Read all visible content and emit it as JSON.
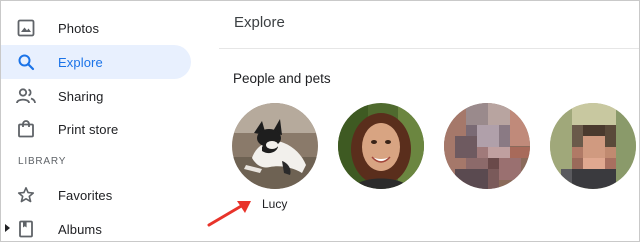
{
  "sidebar": {
    "items": [
      {
        "label": "Photos",
        "icon": "photo-icon"
      },
      {
        "label": "Explore",
        "icon": "search-icon",
        "active": true
      },
      {
        "label": "Sharing",
        "icon": "people-icon"
      },
      {
        "label": "Print store",
        "icon": "shopping-bag-icon"
      }
    ],
    "section_label": "LIBRARY",
    "library_items": [
      {
        "label": "Favorites",
        "icon": "star-icon"
      },
      {
        "label": "Albums",
        "icon": "album-icon"
      }
    ]
  },
  "main": {
    "title": "Explore",
    "section_heading": "People and pets",
    "people": [
      {
        "name": "Lucy",
        "kind": "pet-photo"
      },
      {
        "name": "",
        "kind": "person-photo"
      },
      {
        "name": "",
        "kind": "pixelated-face"
      },
      {
        "name": "",
        "kind": "pixelated-face"
      }
    ]
  },
  "colors": {
    "accent": "#1a73e8",
    "active_bg": "#e8f0fe",
    "arrow": "#e8332a",
    "text": "#202124"
  }
}
